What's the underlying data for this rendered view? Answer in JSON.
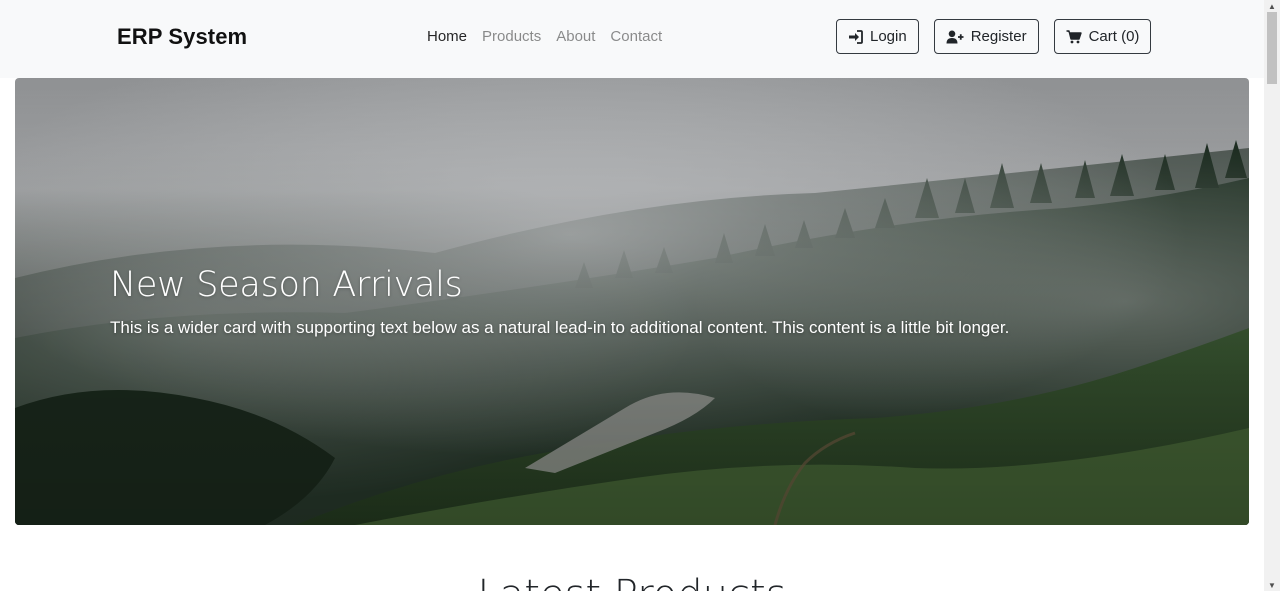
{
  "navbar": {
    "brand": "ERP System",
    "links": [
      {
        "label": "Home",
        "active": true
      },
      {
        "label": "Products",
        "active": false
      },
      {
        "label": "About",
        "active": false
      },
      {
        "label": "Contact",
        "active": false
      }
    ],
    "actions": {
      "login": {
        "label": "Login",
        "icon": "sign-in-icon"
      },
      "register": {
        "label": "Register",
        "icon": "user-plus-icon"
      },
      "cart": {
        "label": "Cart (0)",
        "icon": "cart-icon"
      }
    }
  },
  "hero": {
    "title": "New Season Arrivals",
    "text": "This is a wider card with supporting text below as a natural lead-in to additional content. This content is a little bit longer.",
    "image": "misty-forest-mountain"
  },
  "latest": {
    "title": "Latest Products"
  },
  "colors": {
    "navbar_bg": "#f8f9fa",
    "button_border": "#343a40",
    "text_dark": "#212529"
  }
}
